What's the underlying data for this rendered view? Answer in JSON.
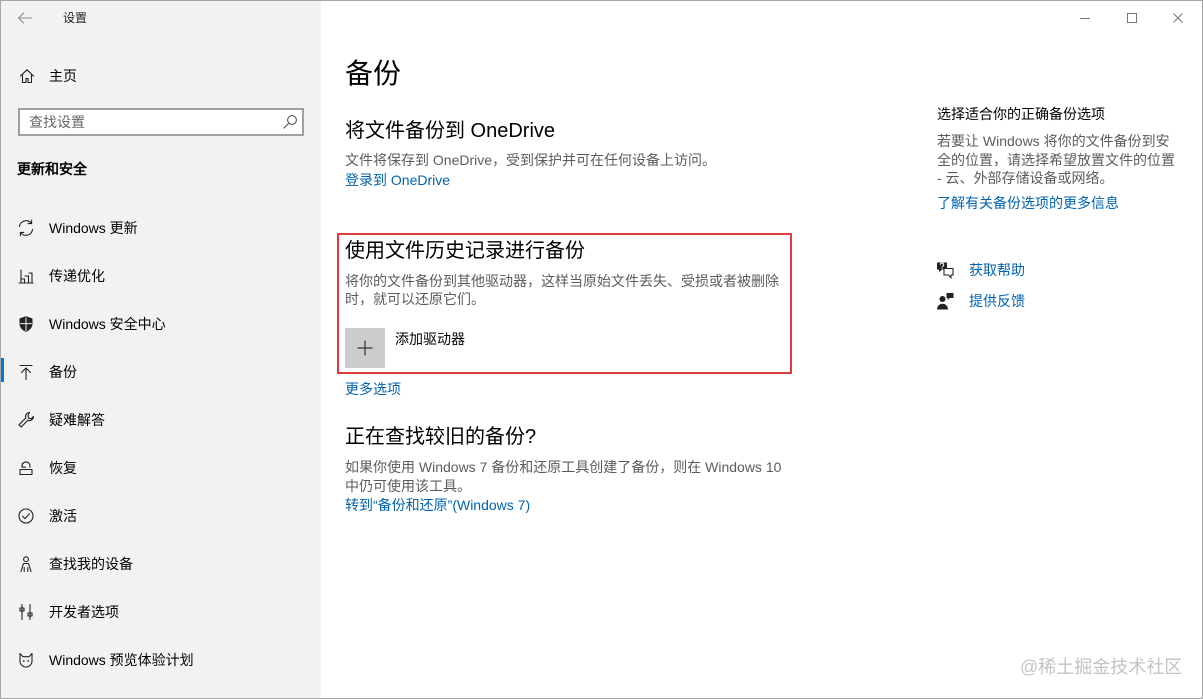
{
  "window": {
    "title": "设置"
  },
  "sidebar": {
    "home": "主页",
    "search_placeholder": "查找设置",
    "section_title": "更新和安全",
    "items": [
      {
        "label": "Windows 更新",
        "icon": "refresh-icon",
        "selected": false
      },
      {
        "label": "传递优化",
        "icon": "delivery-optimization-icon",
        "selected": false
      },
      {
        "label": "Windows 安全中心",
        "icon": "shield-icon",
        "selected": false
      },
      {
        "label": "备份",
        "icon": "backup-upload-icon",
        "selected": true
      },
      {
        "label": "疑难解答",
        "icon": "wrench-icon",
        "selected": false
      },
      {
        "label": "恢复",
        "icon": "recovery-icon",
        "selected": false
      },
      {
        "label": "激活",
        "icon": "check-circle-icon",
        "selected": false
      },
      {
        "label": "查找我的设备",
        "icon": "person-icon",
        "selected": false
      },
      {
        "label": "开发者选项",
        "icon": "developer-tools-icon",
        "selected": false
      },
      {
        "label": "Windows 预览体验计划",
        "icon": "insider-cat-icon",
        "selected": false
      }
    ]
  },
  "main": {
    "page_title": "备份",
    "onedrive": {
      "heading": "将文件备份到 OneDrive",
      "description": "文件将保存到 OneDrive，受到保护并可在任何设备上访问。",
      "link": "登录到 OneDrive"
    },
    "file_history": {
      "heading": "使用文件历史记录进行备份",
      "description_lines": [
        "将你的文件备份到其他驱动器，这样当原始文件丢失、受损或者被删除",
        "时，就可以还原它们。"
      ],
      "add_drive_label": "添加驱动器"
    },
    "more_options_link": "更多选项",
    "older_backup": {
      "heading": "正在查找较旧的备份?",
      "description_lines": [
        "如果你使用 Windows 7 备份和还原工具创建了备份，则在 Windows 10",
        "中仍可使用该工具。"
      ],
      "link": "转到“备份和还原”(Windows 7)"
    }
  },
  "aside": {
    "heading": "选择适合你的正确备份选项",
    "description_lines": [
      "若要让 Windows 将你的文件备份到安",
      "全的位置，请选择希望放置文件的位置",
      "- 云、外部存储设备或网络。"
    ],
    "learn_more_link": "了解有关备份选项的更多信息",
    "get_help": "获取帮助",
    "give_feedback": "提供反馈"
  },
  "watermark": "@稀土掘金技术社区",
  "colors": {
    "accent": "#0078d7",
    "link": "#0063b1",
    "annotation_box": "#e23b3b",
    "sidebar_background": "#f2f2f2",
    "muted_text": "#5c5c5c"
  }
}
